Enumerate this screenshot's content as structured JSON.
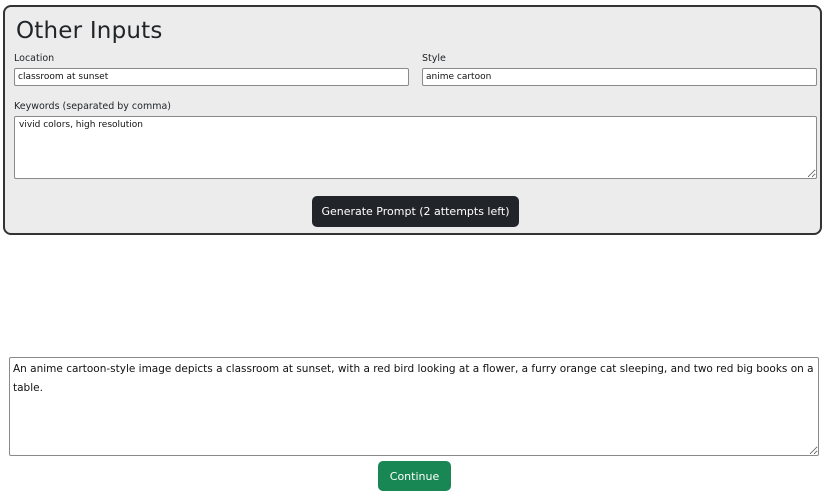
{
  "other_inputs": {
    "title": "Other Inputs",
    "location": {
      "label": "Location",
      "value": "classroom at sunset"
    },
    "style": {
      "label": "Style",
      "value": "anime cartoon"
    },
    "keywords": {
      "label": "Keywords (separated by comma)",
      "value": "vivid colors, high resolution"
    },
    "generate_button": "Generate Prompt (2 attempts left)"
  },
  "output": {
    "prompt_text": "An anime cartoon-style image depicts a classroom at sunset, with a red bird looking at a flower, a furry orange cat sleeping, and two red big books on a table.",
    "continue_button": "Continue"
  },
  "colors": {
    "card_background": "#ececec",
    "card_border": "#333333",
    "dark_button": "#212529",
    "continue_button": "#198754"
  }
}
